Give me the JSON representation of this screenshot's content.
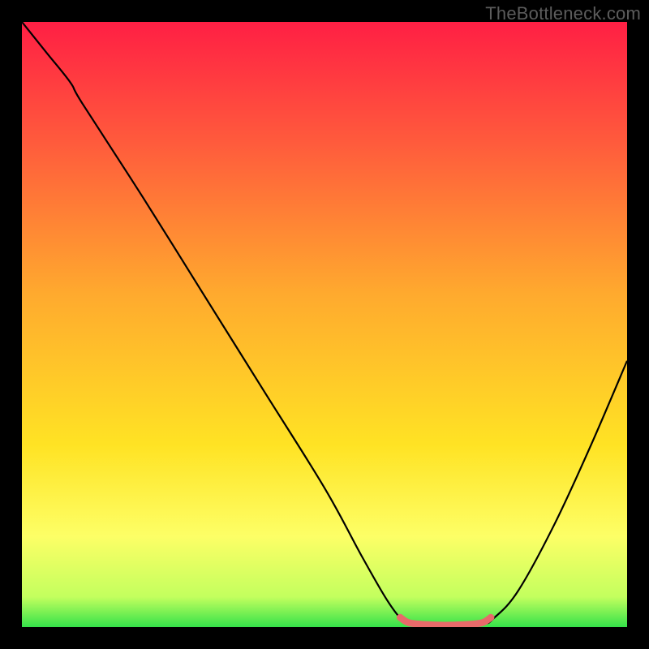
{
  "watermark": "TheBottleneck.com",
  "chart_data": {
    "type": "line",
    "title": "",
    "xlabel": "",
    "ylabel": "",
    "xlim": [
      0,
      100
    ],
    "ylim": [
      0,
      100
    ],
    "gradient_stops": [
      {
        "offset": 0.0,
        "color": "#ff1f44"
      },
      {
        "offset": 0.2,
        "color": "#ff5b3c"
      },
      {
        "offset": 0.45,
        "color": "#ffaa2e"
      },
      {
        "offset": 0.7,
        "color": "#ffe324"
      },
      {
        "offset": 0.85,
        "color": "#fdff66"
      },
      {
        "offset": 0.95,
        "color": "#c3ff5e"
      },
      {
        "offset": 1.0,
        "color": "#35e24a"
      }
    ],
    "series": [
      {
        "name": "bottleneck-curve",
        "color": "#000000",
        "width": 2.2,
        "points": [
          {
            "x": 0.0,
            "y": 100.0
          },
          {
            "x": 4.0,
            "y": 95.0
          },
          {
            "x": 8.0,
            "y": 90.0
          },
          {
            "x": 10.0,
            "y": 86.5
          },
          {
            "x": 20.0,
            "y": 71.0
          },
          {
            "x": 30.0,
            "y": 55.0
          },
          {
            "x": 40.0,
            "y": 39.0
          },
          {
            "x": 50.0,
            "y": 23.0
          },
          {
            "x": 56.0,
            "y": 12.0
          },
          {
            "x": 60.0,
            "y": 5.0
          },
          {
            "x": 62.5,
            "y": 1.5
          },
          {
            "x": 64.0,
            "y": 0.5
          },
          {
            "x": 70.0,
            "y": 0.3
          },
          {
            "x": 76.0,
            "y": 0.5
          },
          {
            "x": 78.0,
            "y": 1.5
          },
          {
            "x": 82.0,
            "y": 6.0
          },
          {
            "x": 88.0,
            "y": 17.0
          },
          {
            "x": 94.0,
            "y": 30.0
          },
          {
            "x": 100.0,
            "y": 44.0
          }
        ]
      },
      {
        "name": "optimal-band",
        "color": "#e86a6a",
        "width": 8.5,
        "linecap": "round",
        "points": [
          {
            "x": 62.5,
            "y": 1.6
          },
          {
            "x": 64.0,
            "y": 0.7
          },
          {
            "x": 67.0,
            "y": 0.4
          },
          {
            "x": 70.0,
            "y": 0.3
          },
          {
            "x": 73.0,
            "y": 0.4
          },
          {
            "x": 76.0,
            "y": 0.7
          },
          {
            "x": 77.5,
            "y": 1.6
          }
        ]
      }
    ]
  }
}
